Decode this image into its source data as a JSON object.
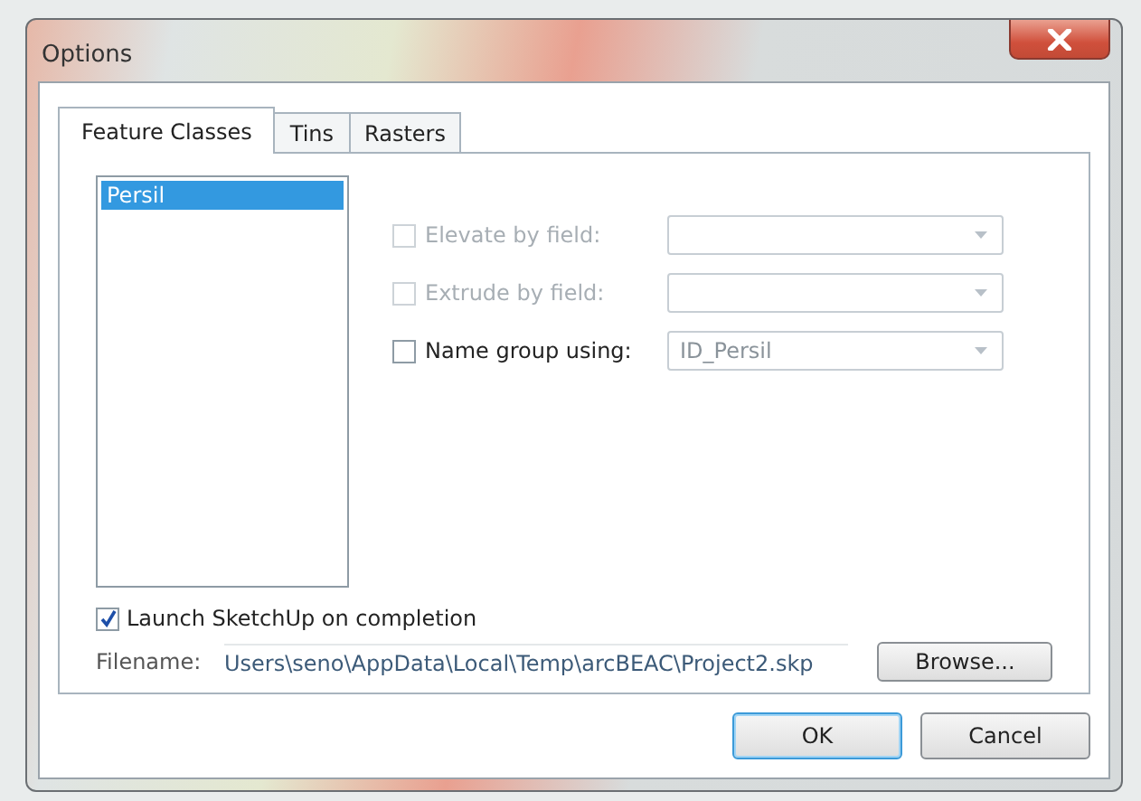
{
  "window": {
    "title": "Options"
  },
  "tabs": [
    {
      "label": "Feature Classes",
      "selected": true
    },
    {
      "label": "Tins",
      "selected": false
    },
    {
      "label": "Rasters",
      "selected": false
    }
  ],
  "feature_list": {
    "items": [
      {
        "label": "Persil",
        "selected": true
      }
    ]
  },
  "fields": [
    {
      "label": "Elevate by field:",
      "checked": false,
      "disabled": true
    },
    {
      "label": "Extrude by field:",
      "checked": false,
      "disabled": true
    },
    {
      "label": "Name group using:",
      "checked": false,
      "disabled": false,
      "value": "ID_Persil"
    }
  ],
  "launch": {
    "label": "Launch SketchUp on completion",
    "checked": true
  },
  "filename": {
    "label": "Filename:",
    "value": "Users\\seno\\AppData\\Local\\Temp\\arcBEAC\\Project2.skp"
  },
  "browse_button": "Browse...",
  "buttons": [
    {
      "label": "OK",
      "default": true
    },
    {
      "label": "Cancel",
      "default": false
    }
  ]
}
